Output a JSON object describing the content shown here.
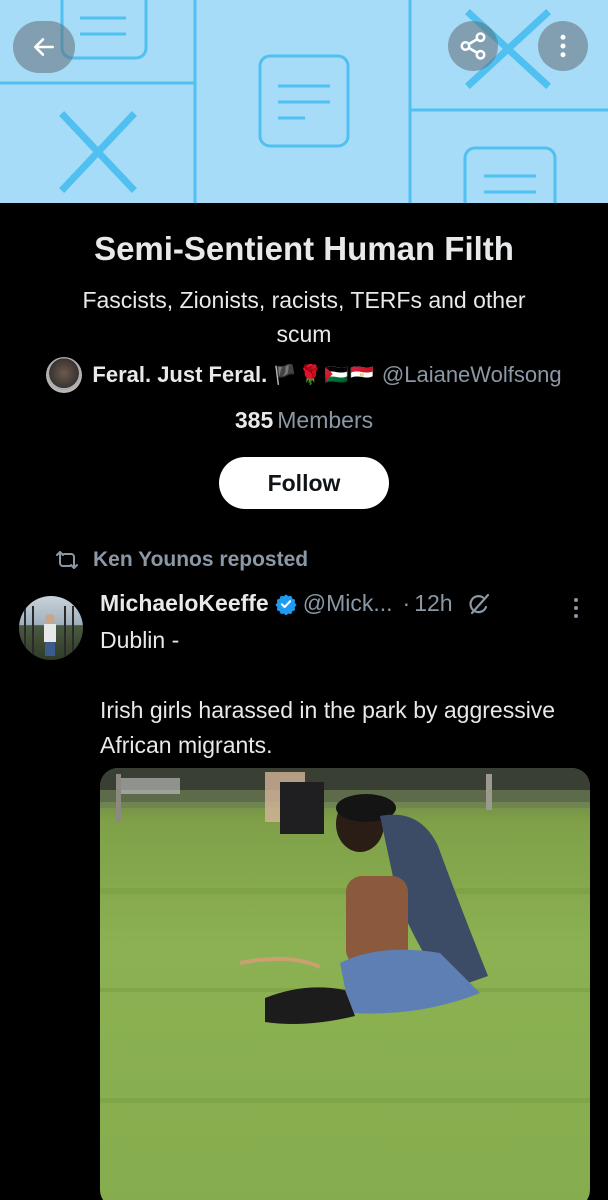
{
  "banner": {
    "back_icon": "arrow-left-icon",
    "share_icon": "share-icon",
    "more_icon": "more-vertical-icon",
    "background_color": "#a6dcf7",
    "pattern_color": "#4fc0f0"
  },
  "community": {
    "title": "Semi-Sentient Human Filth",
    "description": "Fascists, Zionists, racists, TERFs and other scum",
    "owner_name": "Feral. Just Feral.",
    "owner_flags": "🏴🌹🇵🇸🇪🇬",
    "owner_handle": "@LaianeWolfsong",
    "members_count": "385",
    "members_label": "Members",
    "follow_label": "Follow"
  },
  "tweet": {
    "repost_text": "Ken Younos reposted",
    "author_name": "MichaeloKeeffe",
    "author_handle": "@Mick...",
    "time": "12h",
    "text_line1": "Dublin -",
    "text_line2": "",
    "text_line3": "Irish girls harassed in the park by aggressive African migrants.",
    "verified_color": "#1d9bf0",
    "media": "video-thumbnail"
  }
}
